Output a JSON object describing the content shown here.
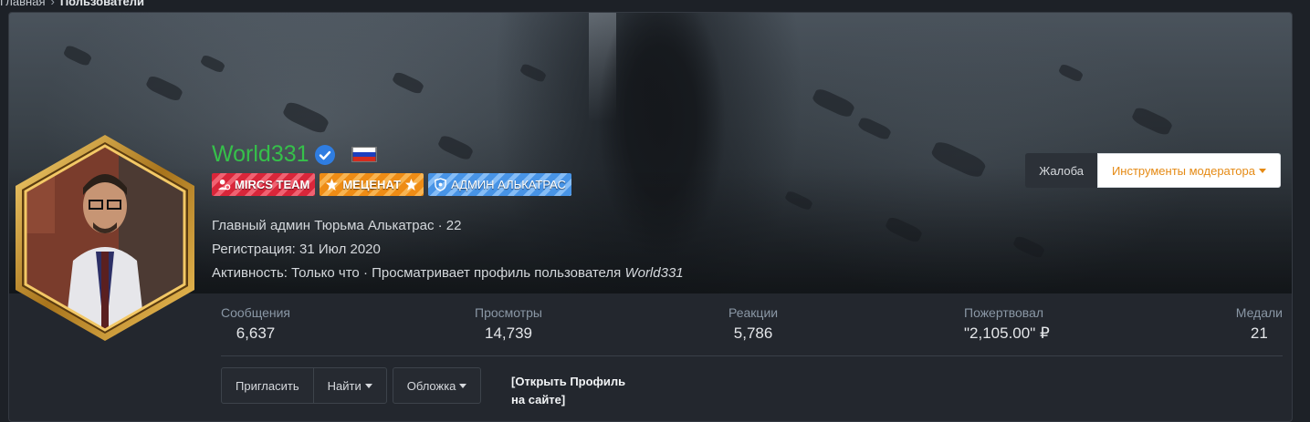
{
  "breadcrumb": {
    "home": "Главная",
    "current": "Пользователи"
  },
  "profile": {
    "username": "World331",
    "username_color": "#36c04a",
    "verified_icon": "verified-check-icon",
    "flag_icon": "russia-flag-icon",
    "badges": [
      {
        "label": "MIRCS TEAM",
        "icon": "user-gear-icon",
        "color": "#d9263a"
      },
      {
        "label": "МЕЦЕНАТ",
        "icon": "star-icon",
        "color": "#ee8c15"
      },
      {
        "label": "АДМИН АЛЬКАТРАС",
        "icon": "shield-icon",
        "color": "#4894e6"
      }
    ],
    "title_line": "Главный админ Тюрьма Алькатрас · 22",
    "registration": "Регистрация: 31 Июл 2020",
    "activity_prefix": "Активность: Только что · Просматривает профиль пользователя ",
    "activity_user": "World331"
  },
  "actions": {
    "report": "Жалоба",
    "moderator_tools": "Инструменты модератора"
  },
  "stats": {
    "messages": {
      "label": "Сообщения",
      "value": "6,637"
    },
    "views": {
      "label": "Просмотры",
      "value": "14,739"
    },
    "reactions": {
      "label": "Реакции",
      "value": "5,786"
    },
    "donated": {
      "label": "Пожертвовал",
      "value": "\"2,105.00\" ₽"
    },
    "medals": {
      "label": "Медали",
      "value": "21"
    }
  },
  "toolbar": {
    "invite": "Пригласить",
    "find": "Найти",
    "cover": "Обложка",
    "open_profile_line1": "[Открыть Профиль",
    "open_profile_line2": "на сайте]"
  },
  "colors": {
    "accent_orange": "#e58a14",
    "background": "#23272e"
  }
}
